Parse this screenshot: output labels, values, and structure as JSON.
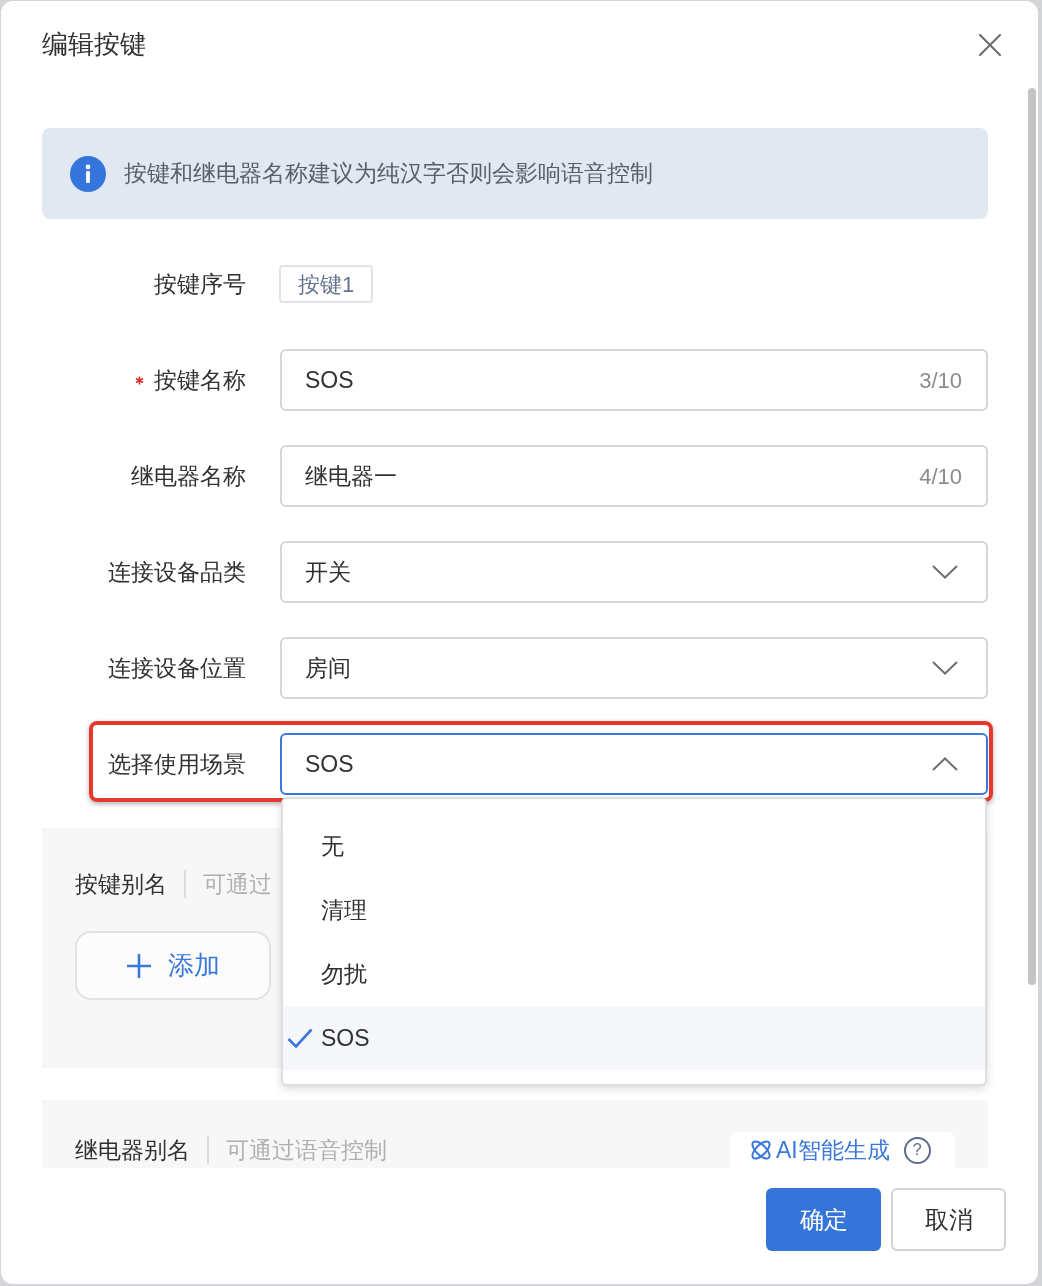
{
  "dialog": {
    "title": "编辑按键"
  },
  "notice": {
    "text": "按键和继电器名称建议为纯汉字否则会影响语音控制"
  },
  "form": [
    {
      "kind": "tag",
      "label": "按键序号",
      "required": false,
      "highlighted": false,
      "value": "按键1"
    },
    {
      "kind": "input",
      "label": "按键名称",
      "required": true,
      "highlighted": false,
      "value": "SOS",
      "counter": "3/10"
    },
    {
      "kind": "input",
      "label": "继电器名称",
      "required": false,
      "highlighted": false,
      "value": "继电器一",
      "counter": "4/10"
    },
    {
      "kind": "select",
      "label": "连接设备品类",
      "required": false,
      "highlighted": false,
      "value": "开关",
      "expanded": false
    },
    {
      "kind": "select",
      "label": "连接设备位置",
      "required": false,
      "highlighted": false,
      "value": "房间",
      "expanded": false
    },
    {
      "kind": "select",
      "label": "选择使用场景",
      "required": false,
      "highlighted": true,
      "value": "SOS",
      "expanded": true,
      "options": [
        {
          "label": "无",
          "selected": false
        },
        {
          "label": "清理",
          "selected": false
        },
        {
          "label": "勿扰",
          "selected": false
        },
        {
          "label": "SOS",
          "selected": true
        }
      ]
    }
  ],
  "alias_sections": [
    {
      "kind": "add",
      "label": "按键别名",
      "hint": "可通过",
      "button": "添加"
    },
    {
      "kind": "ai",
      "label": "继电器别名",
      "hint": "可通过语音控制",
      "button": "AI智能生成",
      "help": "?"
    }
  ],
  "buttons": [
    {
      "kind": "primary",
      "label": "确定"
    },
    {
      "kind": "default",
      "label": "取消"
    }
  ]
}
